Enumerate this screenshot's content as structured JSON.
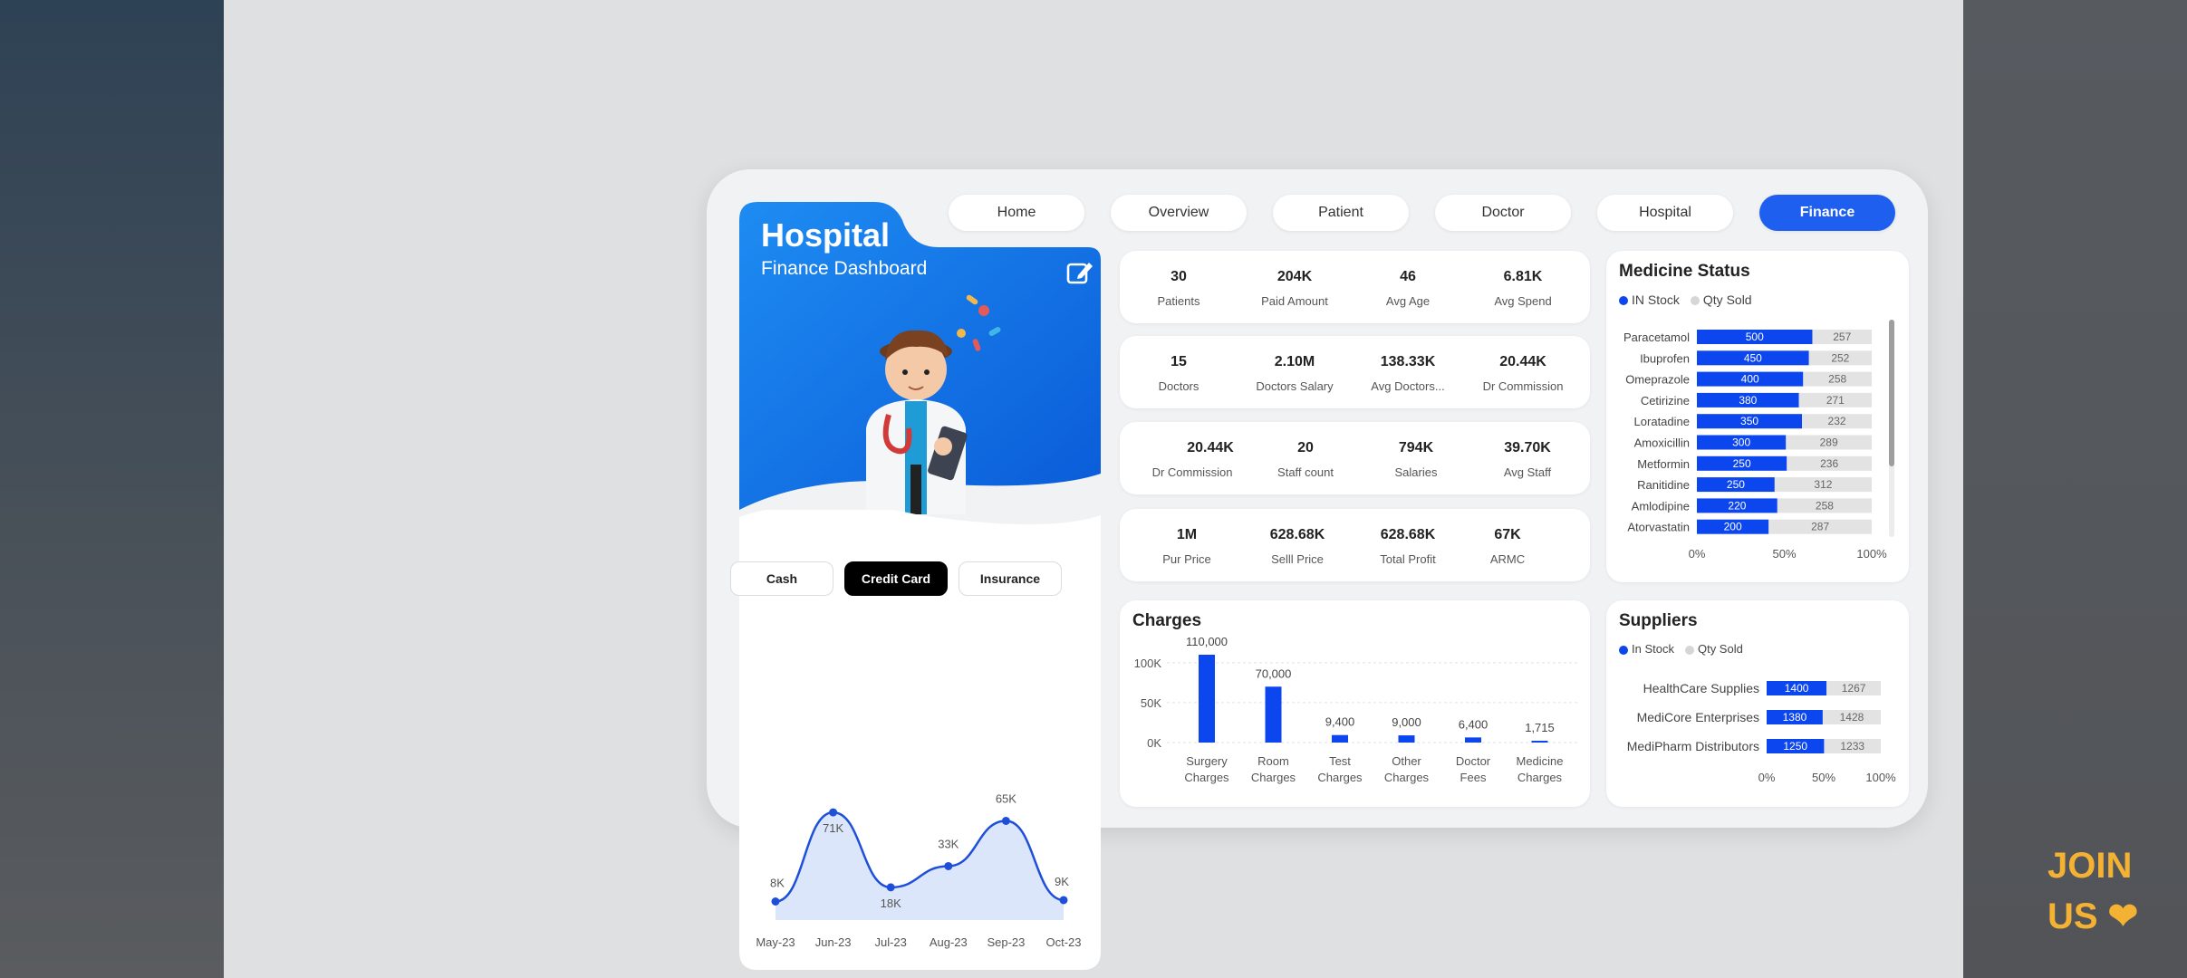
{
  "colors": {
    "accent": "#1f5ff0",
    "bar_blue": "#0b46ee",
    "bar_grey": "#e3e3e3",
    "hero_blue": "#0e6ee6"
  },
  "hero": {
    "title": "Hospital",
    "subtitle": "Finance Dashboard",
    "edit_icon": "edit-icon",
    "illustration": "doctor-illustration"
  },
  "nav": [
    {
      "label": "Home",
      "active": false
    },
    {
      "label": "Overview",
      "active": false
    },
    {
      "label": "Patient",
      "active": false
    },
    {
      "label": "Doctor",
      "active": false
    },
    {
      "label": "Hospital",
      "active": false
    },
    {
      "label": "Finance",
      "active": true
    }
  ],
  "payment_tabs": [
    {
      "label": "Cash",
      "active": false
    },
    {
      "label": "Credit Card",
      "active": true
    },
    {
      "label": "Insurance",
      "active": false
    }
  ],
  "kpi_rows": [
    [
      {
        "value": "30",
        "label": "Patients"
      },
      {
        "value": "204K",
        "label": "Paid Amount"
      },
      {
        "value": "46",
        "label": "Avg Age"
      },
      {
        "value": "6.81K",
        "label": "Avg Spend"
      }
    ],
    [
      {
        "value": "15",
        "label": "Doctors"
      },
      {
        "value": "2.10M",
        "label": "Doctors Salary"
      },
      {
        "value": "138.33K",
        "label": "Avg Doctors..."
      },
      {
        "value": "20.44K",
        "label": "Dr Commission"
      }
    ],
    [
      {
        "value": "20.44K",
        "label": "Dr Commission"
      },
      {
        "value": "20",
        "label": "Staff count"
      },
      {
        "value": "794K",
        "label": "Salaries"
      },
      {
        "value": "39.70K",
        "label": "Avg Staff"
      }
    ],
    [
      {
        "value": "1M",
        "label": "Pur Price"
      },
      {
        "value": "628.68K",
        "label": "Selll Price"
      },
      {
        "value": "628.68K",
        "label": "Total Profit"
      },
      {
        "value": "67K",
        "label": "ARMC"
      }
    ]
  ],
  "chart_data": [
    {
      "type": "area",
      "x": [
        "May-23",
        "Jun-23",
        "Jul-23",
        "Aug-23",
        "Sep-23",
        "Oct-23"
      ],
      "values": [
        8,
        71,
        18,
        33,
        65,
        9
      ],
      "data_labels": [
        "8K",
        "71K",
        "18K",
        "33K",
        "65K",
        "9K"
      ],
      "ylim": [
        0,
        80
      ]
    },
    {
      "type": "bar",
      "title": "Charges",
      "categories": [
        "Surgery Charges",
        "Room Charges",
        "Test Charges",
        "Other Charges",
        "Doctor Fees",
        "Medicine Charges"
      ],
      "values": [
        110000,
        70000,
        9400,
        9000,
        6400,
        1715
      ],
      "data_labels": [
        "110,000",
        "70,000",
        "9,400",
        "9,000",
        "6,400",
        "1,715"
      ],
      "ytick_labels": [
        "100K",
        "50K",
        "0K"
      ],
      "ylim": [
        0,
        110000
      ],
      "grid": true
    },
    {
      "type": "bar",
      "orientation": "horizontal",
      "stacked_100": true,
      "title": "Medicine Status",
      "legend": [
        "IN Stock",
        "Qty Sold"
      ],
      "categories": [
        "Paracetamol",
        "Ibuprofen",
        "Omeprazole",
        "Cetirizine",
        "Loratadine",
        "Amoxicillin",
        "Metformin",
        "Ranitidine",
        "Amlodipine",
        "Atorvastatin"
      ],
      "series": [
        {
          "name": "IN Stock",
          "values": [
            500,
            450,
            400,
            380,
            350,
            300,
            250,
            250,
            220,
            200
          ]
        },
        {
          "name": "Qty Sold",
          "values": [
            257,
            252,
            258,
            271,
            232,
            289,
            236,
            312,
            258,
            287
          ]
        }
      ],
      "xtick_labels": [
        "0%",
        "50%",
        "100%"
      ]
    },
    {
      "type": "bar",
      "orientation": "horizontal",
      "stacked_100": true,
      "title": "Suppliers",
      "legend": [
        "In Stock",
        "Qty Sold"
      ],
      "categories": [
        "HealthCare Supplies",
        "MediCore Enterprises",
        "MediPharm Distributors"
      ],
      "series": [
        {
          "name": "In Stock",
          "values": [
            1400,
            1380,
            1250
          ]
        },
        {
          "name": "Qty Sold",
          "values": [
            1267,
            1428,
            1233
          ]
        }
      ],
      "xtick_labels": [
        "0%",
        "50%",
        "100%"
      ]
    }
  ],
  "promo": {
    "line1": "JOIN",
    "line2": "US ❤"
  }
}
